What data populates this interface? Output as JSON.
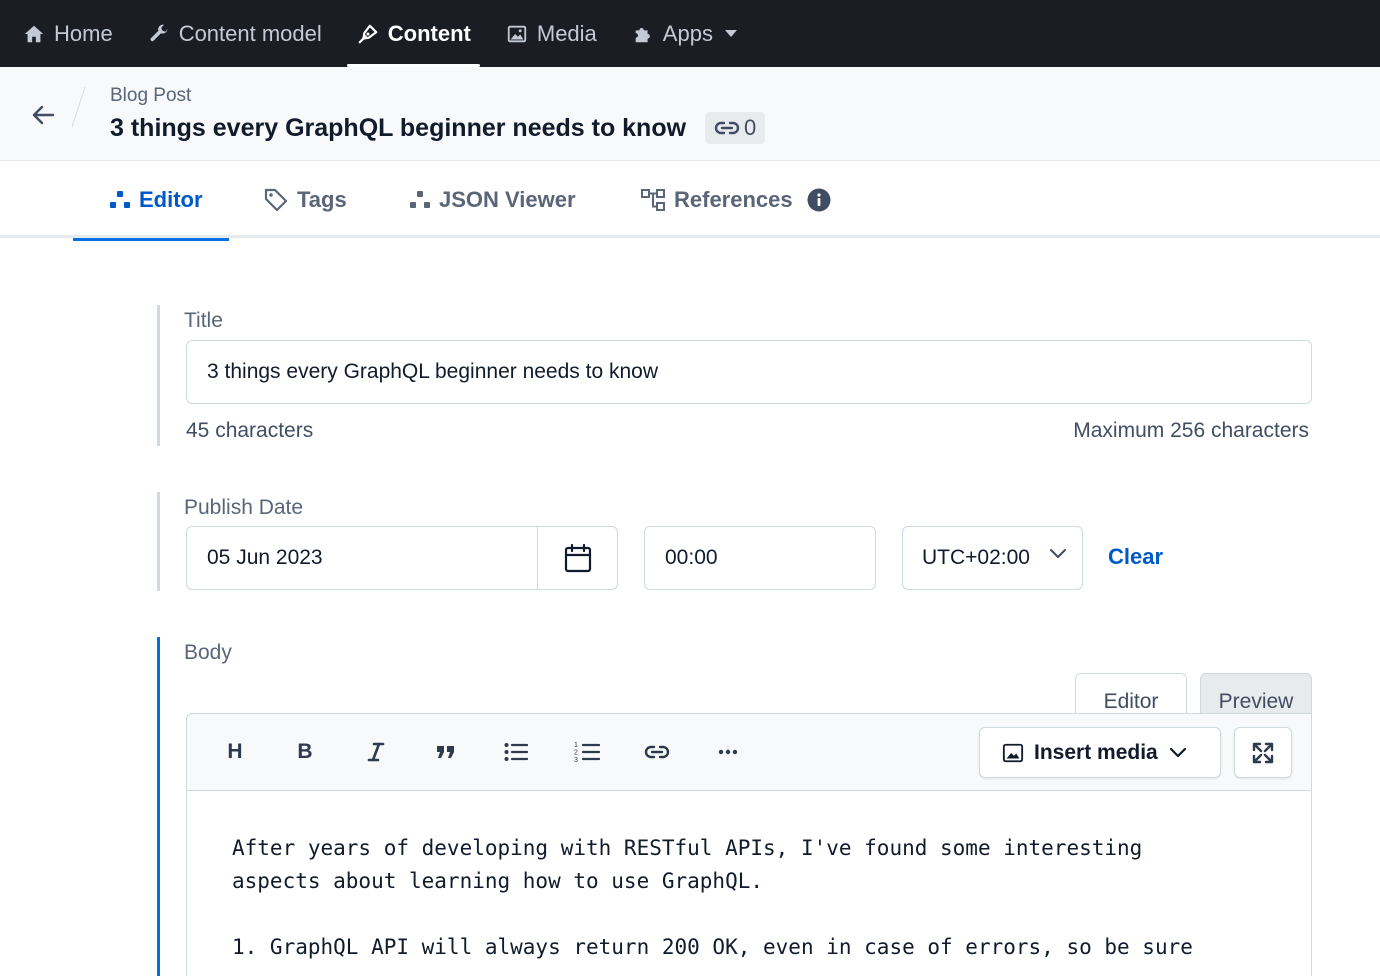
{
  "topnav": {
    "items": [
      {
        "label": "Home",
        "icon": "home-icon"
      },
      {
        "label": "Content model",
        "icon": "wrench-icon"
      },
      {
        "label": "Content",
        "icon": "pen-nib-icon",
        "active": true
      },
      {
        "label": "Media",
        "icon": "image-icon"
      },
      {
        "label": "Apps",
        "icon": "puzzle-icon"
      }
    ]
  },
  "entry": {
    "content_type": "Blog Post",
    "title": "3 things every GraphQL beginner needs to know",
    "reference_count": "0"
  },
  "tabs": [
    {
      "label": "Editor",
      "active": true
    },
    {
      "label": "Tags"
    },
    {
      "label": "JSON Viewer"
    },
    {
      "label": "References"
    }
  ],
  "fields": {
    "title": {
      "label": "Title",
      "value": "3 things every GraphQL beginner needs to know",
      "char_count": "45 characters",
      "max_hint": "Maximum 256 characters"
    },
    "publish_date": {
      "label": "Publish Date",
      "date": "05 Jun 2023",
      "time": "00:00",
      "timezone": "UTC+02:00",
      "clear_label": "Clear"
    },
    "body": {
      "label": "Body",
      "mode_editor": "Editor",
      "mode_preview": "Preview",
      "toolbar": {
        "heading": "H",
        "bold": "B",
        "insert_media": "Insert media"
      },
      "text": "After years of developing with RESTful APIs, I've found some interesting\naspects about learning how to use GraphQL.\n\n1. GraphQL API will always return 200 OK, even in case of errors, so be sure"
    }
  },
  "colors": {
    "nav_bg": "#1a1d24",
    "accent": "#036fe3",
    "link": "#0059c8",
    "border": "#cfd9e0"
  }
}
